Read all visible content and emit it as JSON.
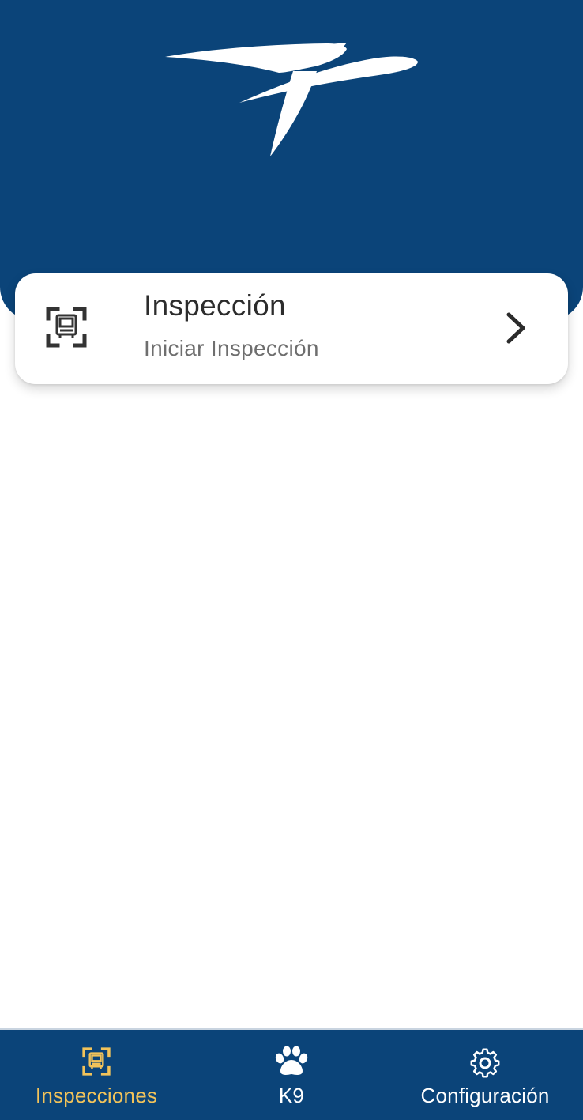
{
  "app": {
    "logo_icon": "eagle-logo-icon",
    "colors": {
      "brand_blue": "#0b4479",
      "active_gold": "#f2c35a",
      "card_background": "#ffffff",
      "title_text": "#2c2c2c",
      "subtitle_text": "#6e6e6e"
    }
  },
  "card": {
    "icon": "vehicle-scan-icon",
    "title": "Inspección",
    "subtitle": "Iniciar Inspección",
    "action_icon": "chevron-right-icon"
  },
  "bottom_nav": {
    "items": [
      {
        "label": "Inspecciones",
        "icon": "vehicle-scan-icon",
        "active": true
      },
      {
        "label": "K9",
        "icon": "paw-icon",
        "active": false
      },
      {
        "label": "Configuración",
        "icon": "gear-icon",
        "active": false
      }
    ]
  }
}
